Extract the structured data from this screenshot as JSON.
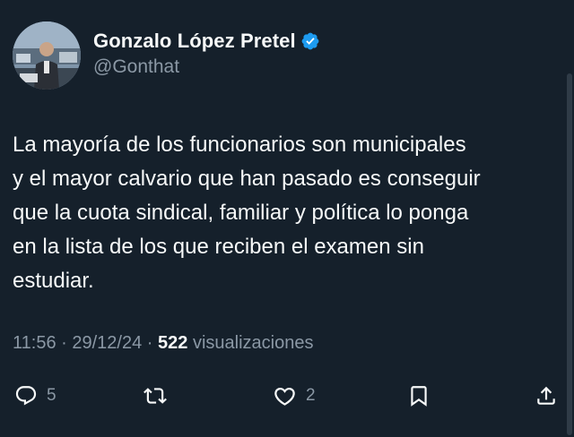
{
  "author": {
    "display_name": "Gonzalo López Pretel",
    "handle": "@Gonthat",
    "verified": true
  },
  "tweet": {
    "lines": [
      "La mayoría de los funcionarios son municipales",
      "y el mayor calvario que han pasado es conseguir",
      "que la cuota sindical, familiar y política lo ponga",
      "en la lista de los que reciben el examen sin",
      "estudiar."
    ],
    "time": "11:56",
    "separator": "·",
    "date": "29/12/24",
    "views_count": "522",
    "views_label": "visualizaciones"
  },
  "actions": {
    "replies": "5",
    "likes": "2"
  },
  "colors": {
    "background": "#15202b",
    "text": "#f7f9f9",
    "secondary": "#8b98a5",
    "verified": "#1d9bf0"
  },
  "icons": {
    "reply": "reply-icon",
    "retweet": "retweet-icon",
    "like": "heart-icon",
    "bookmark": "bookmark-icon",
    "share": "share-icon",
    "verified": "verified-badge-icon"
  }
}
